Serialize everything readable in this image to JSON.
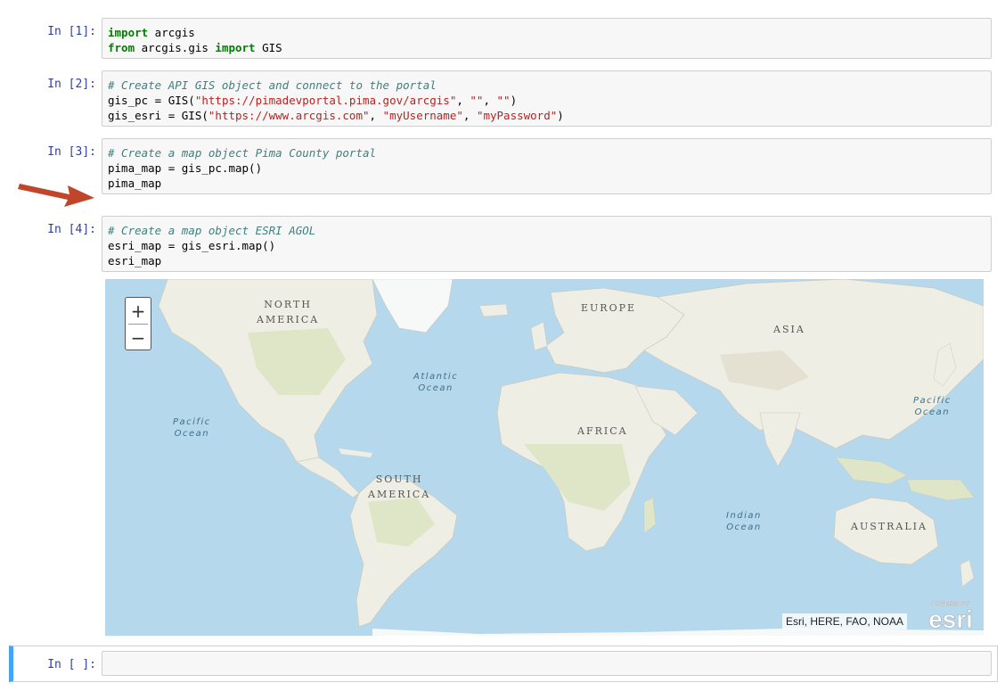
{
  "cells": [
    {
      "prompt": "In [1]:",
      "lines": [
        [
          {
            "t": "import",
            "c": "kw"
          },
          {
            "t": " arcgis",
            "c": ""
          }
        ],
        [
          {
            "t": "from",
            "c": "kw"
          },
          {
            "t": " arcgis.gis ",
            "c": ""
          },
          {
            "t": "import",
            "c": "kw"
          },
          {
            "t": " GIS",
            "c": ""
          }
        ]
      ]
    },
    {
      "prompt": "In [2]:",
      "lines": [
        [
          {
            "t": "# Create API GIS object and connect to the portal",
            "c": "cm"
          }
        ],
        [
          {
            "t": "gis_pc = GIS(",
            "c": ""
          },
          {
            "t": "\"https://pimadevportal.pima.gov/arcgis\"",
            "c": "st"
          },
          {
            "t": ", ",
            "c": ""
          },
          {
            "t": "\"\"",
            "c": "st"
          },
          {
            "t": ", ",
            "c": ""
          },
          {
            "t": "\"\"",
            "c": "st"
          },
          {
            "t": ")",
            "c": ""
          }
        ],
        [
          {
            "t": "gis_esri = GIS(",
            "c": ""
          },
          {
            "t": "\"https://www.arcgis.com\"",
            "c": "st"
          },
          {
            "t": ", ",
            "c": ""
          },
          {
            "t": "\"myUsername\"",
            "c": "st"
          },
          {
            "t": ", ",
            "c": ""
          },
          {
            "t": "\"myPassword\"",
            "c": "st"
          },
          {
            "t": ")",
            "c": ""
          }
        ]
      ]
    },
    {
      "prompt": "In [3]:",
      "lines": [
        [
          {
            "t": "# Create a map object Pima County portal",
            "c": "cm"
          }
        ],
        [
          {
            "t": "pima_map = gis_pc.map()",
            "c": ""
          }
        ],
        [
          {
            "t": "pima_map",
            "c": ""
          }
        ]
      ]
    },
    {
      "prompt": "In [4]:",
      "lines": [
        [
          {
            "t": "# Create a map object ESRI AGOL",
            "c": "cm"
          }
        ],
        [
          {
            "t": "esri_map = gis_esri.map()",
            "c": ""
          }
        ],
        [
          {
            "t": "esri_map",
            "c": ""
          }
        ]
      ]
    }
  ],
  "empty_cell": {
    "prompt": "In [ ]:"
  },
  "map": {
    "zoom_in": "+",
    "zoom_out": "−",
    "continents": {
      "north_america": [
        "NORTH",
        "AMERICA"
      ],
      "south_america": [
        "SOUTH",
        "AMERICA"
      ],
      "europe": "EUROPE",
      "asia": "ASIA",
      "africa": "AFRICA",
      "australia": "AUSTRALIA"
    },
    "oceans": {
      "atlantic": [
        "Atlantic",
        "Ocean"
      ],
      "pacific_west": [
        "Pacific",
        "Ocean"
      ],
      "pacific_east": [
        "Pacific",
        "Ocean"
      ],
      "indian": [
        "Indian",
        "Ocean"
      ]
    },
    "attribution": "Esri, HERE, FAO, NOAA",
    "logo_powered": "POWERED BY",
    "logo_name": "esri"
  },
  "colors": {
    "ocean": "#b5d8ec",
    "land": "#efeee4",
    "vegetation": "#dfe6c8",
    "ice": "#f7f8f8",
    "arrow": "#c0452a",
    "prompt": "#303f9f",
    "selected_border": "#42a5f5"
  }
}
